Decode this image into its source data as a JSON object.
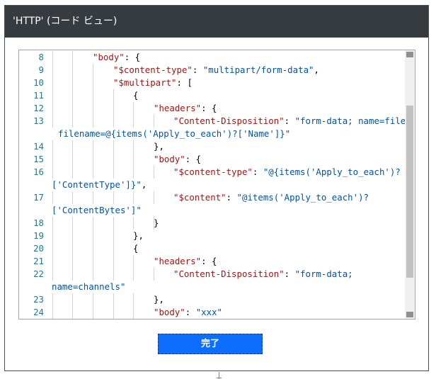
{
  "dialog": {
    "title": "'HTTP' (コード ビュー)",
    "done_label": "完了"
  },
  "colors": {
    "titlebar": "#363b40",
    "key": "#a31515",
    "string": "#0451a5",
    "line_number": "#237893",
    "button": "#0d6efd"
  },
  "code": {
    "lines": [
      {
        "num": "8",
        "segs": [
          {
            "t": "\"body\"",
            "c": "key"
          },
          {
            "t": ": {",
            "c": "pun"
          }
        ]
      },
      {
        "num": "9",
        "segs": [
          {
            "t": "\"$content-type\"",
            "c": "key"
          },
          {
            "t": ": ",
            "c": "pun"
          },
          {
            "t": "\"multipart/form-data\"",
            "c": "str"
          },
          {
            "t": ",",
            "c": "pun"
          }
        ]
      },
      {
        "num": "10",
        "segs": [
          {
            "t": "\"$multipart\"",
            "c": "key"
          },
          {
            "t": ": [",
            "c": "pun"
          }
        ]
      },
      {
        "num": "11",
        "segs": [
          {
            "t": "{",
            "c": "pun"
          }
        ]
      },
      {
        "num": "12",
        "segs": [
          {
            "t": "\"headers\"",
            "c": "key"
          },
          {
            "t": ": {",
            "c": "pun"
          }
        ]
      },
      {
        "num": "13",
        "segs": [
          {
            "t": "\"Content-Disposition\"",
            "c": "key"
          },
          {
            "t": ": ",
            "c": "pun"
          },
          {
            "t": "\"form-data; name=file;",
            "c": "str"
          }
        ]
      },
      {
        "num": "",
        "segs": [
          {
            "t": "filename=@{items('Apply_to_each')?['Name']}\"",
            "c": "str"
          }
        ]
      },
      {
        "num": "14",
        "segs": [
          {
            "t": "},",
            "c": "pun"
          }
        ]
      },
      {
        "num": "15",
        "segs": [
          {
            "t": "\"body\"",
            "c": "key"
          },
          {
            "t": ": {",
            "c": "pun"
          }
        ]
      },
      {
        "num": "16",
        "segs": [
          {
            "t": "\"$content-type\"",
            "c": "key"
          },
          {
            "t": ": ",
            "c": "pun"
          },
          {
            "t": "\"@{items('Apply_to_each')?",
            "c": "str"
          }
        ]
      },
      {
        "num": "",
        "segs": [
          {
            "t": "['ContentType']}\"",
            "c": "str"
          },
          {
            "t": ",",
            "c": "pun"
          }
        ]
      },
      {
        "num": "17",
        "segs": [
          {
            "t": "\"$content\"",
            "c": "key"
          },
          {
            "t": ": ",
            "c": "pun"
          },
          {
            "t": "\"@items('Apply_to_each')?",
            "c": "str"
          }
        ]
      },
      {
        "num": "",
        "segs": [
          {
            "t": "['ContentBytes']\"",
            "c": "str"
          }
        ]
      },
      {
        "num": "18",
        "segs": [
          {
            "t": "}",
            "c": "pun"
          }
        ]
      },
      {
        "num": "19",
        "segs": [
          {
            "t": "},",
            "c": "pun"
          }
        ]
      },
      {
        "num": "20",
        "segs": [
          {
            "t": "{",
            "c": "pun"
          }
        ]
      },
      {
        "num": "21",
        "segs": [
          {
            "t": "\"headers\"",
            "c": "key"
          },
          {
            "t": ": {",
            "c": "pun"
          }
        ]
      },
      {
        "num": "22",
        "segs": [
          {
            "t": "\"Content-Disposition\"",
            "c": "key"
          },
          {
            "t": ": ",
            "c": "pun"
          },
          {
            "t": "\"form-data;",
            "c": "str"
          }
        ]
      },
      {
        "num": "",
        "segs": [
          {
            "t": "name=channels\"",
            "c": "str"
          }
        ]
      },
      {
        "num": "23",
        "segs": [
          {
            "t": "},",
            "c": "pun"
          }
        ]
      },
      {
        "num": "24",
        "segs": [
          {
            "t": "\"body\"",
            "c": "key"
          },
          {
            "t": ": ",
            "c": "pun"
          },
          {
            "t": "\"xxx\"",
            "c": "str"
          }
        ]
      }
    ]
  }
}
